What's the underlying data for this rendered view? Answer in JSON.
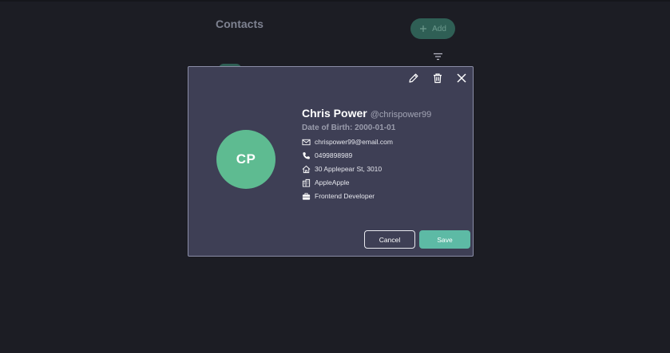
{
  "page": {
    "title": "Contacts",
    "add_label": "Add"
  },
  "contact": {
    "initials": "CP",
    "name": "Chris Power",
    "handle": "@chrispower99",
    "dob": "Date of Birth: 2000-01-01",
    "email": "chrispower99@email.com",
    "phone": "0499898989",
    "address": "30 Applepear St, 3010",
    "company": "AppleApple",
    "job": "Frontend Developer"
  },
  "modal": {
    "cancel_label": "Cancel",
    "save_label": "Save"
  },
  "colors": {
    "avatar": "#5ebb91",
    "accent": "#5dbaa5",
    "modal_bg": "#3e3f55",
    "page_bg": "#1c1d24"
  },
  "icons": [
    "plus-icon",
    "filter-icon",
    "pencil-icon",
    "trash-icon",
    "close-icon",
    "email-icon",
    "phone-icon",
    "home-icon",
    "building-icon",
    "briefcase-icon"
  ]
}
